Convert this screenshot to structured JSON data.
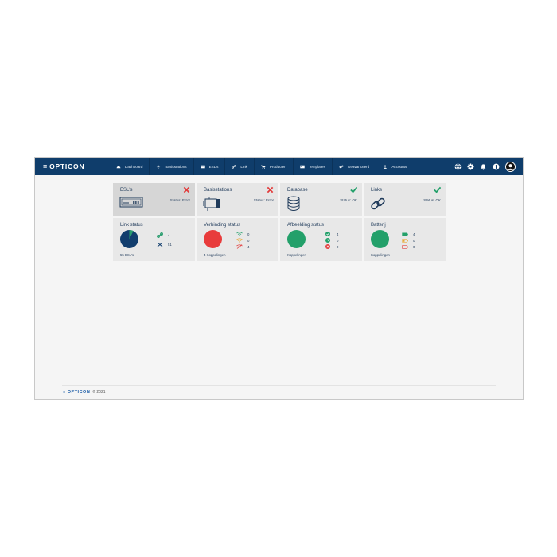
{
  "brand": {
    "name": "OPTICON",
    "menu_glyph": "≡"
  },
  "nav": [
    {
      "label": "Dashboard",
      "icon": "dashboard-icon"
    },
    {
      "label": "Basisstations",
      "icon": "wifi-icon"
    },
    {
      "label": "ESL's",
      "icon": "esl-icon"
    },
    {
      "label": "Link",
      "icon": "link-icon"
    },
    {
      "label": "Producten",
      "icon": "cart-icon"
    },
    {
      "label": "Templates",
      "icon": "template-icon"
    },
    {
      "label": "Geavanceerd",
      "icon": "gears-icon"
    },
    {
      "label": "Accounts",
      "icon": "user-icon"
    }
  ],
  "status_cards": [
    {
      "title": "ESL's",
      "status": "Status: Error",
      "state": "error"
    },
    {
      "title": "Basisstations",
      "status": "Status: Error",
      "state": "error"
    },
    {
      "title": "Database",
      "status": "Status: OK",
      "state": "ok"
    },
    {
      "title": "Links",
      "status": "Status: OK",
      "state": "ok"
    }
  ],
  "link_status": {
    "title": "Link status",
    "linked": "4",
    "unlinked": "51",
    "footer": "55 ESL's",
    "linked_fraction": 0.073,
    "pie_colors": {
      "linked": "#2a9d6e",
      "unlinked": "#123e6e"
    }
  },
  "verbinding_status": {
    "title": "Verbinding status",
    "values": [
      "0",
      "0",
      "4"
    ],
    "footer": "4 Koppelingen",
    "color": "#e83b3b"
  },
  "afbeelding_status": {
    "title": "Afbeelding status",
    "values": [
      "4",
      "0",
      "0"
    ],
    "footer": "Koppelingen",
    "color": "#23a06a"
  },
  "batterij": {
    "title": "Batterij",
    "values": [
      "4",
      "0",
      "0"
    ],
    "footer": "Koppelingen",
    "color": "#23a06a"
  },
  "footer": {
    "brand": "OPTICON",
    "copyright": "© 2021"
  },
  "colors": {
    "nav": "#0f3d6b",
    "error": "#e23b3b",
    "ok": "#23a06a",
    "text": "#1f3a5a"
  }
}
